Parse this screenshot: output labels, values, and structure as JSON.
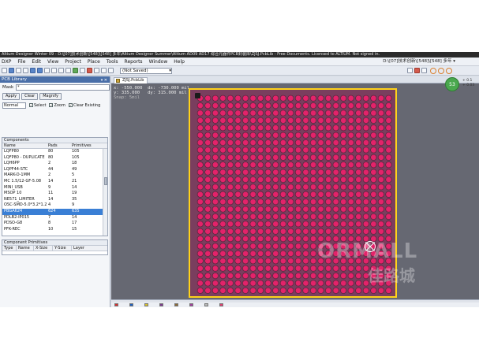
{
  "window": {
    "title": "Altium Designer Winter 09 - D:\\[07]技术创新\\[548]\\[548] 多年\\Altium Designer Summer\\Altium AD09 AD17 综合元器件PCB封装库\\ZJSJ.PcbLib - Free Documents. Licensed to ALTIUM. Not signed in."
  },
  "menu": [
    "DXP",
    "File",
    "Edit",
    "View",
    "Project",
    "Place",
    "Tools",
    "Reports",
    "Window",
    "Help"
  ],
  "path_label": "D:\\[07]技术创新\\[548]\\[548] 多年 ▾",
  "toolbar": {
    "variant": "(Not Saved)"
  },
  "panel": {
    "title": "PCB Library",
    "mask_label": "Mask",
    "mask_value": "*",
    "buttons": {
      "apply": "Apply",
      "clear": "Clear",
      "magnify": "Magnify"
    },
    "mode": "Normal",
    "options": {
      "select": "Select",
      "zoom": "Zoom",
      "clear_existing": "Clear Existing"
    },
    "components": {
      "title": "Components",
      "headers": [
        "Name",
        "Pads",
        "Primitives"
      ],
      "rows": [
        [
          "LQFP80",
          "80",
          "105"
        ],
        [
          "LQFP80 - DUPLICATE",
          "80",
          "105"
        ],
        [
          "LQH6PP",
          "2",
          "18"
        ],
        [
          "LQPF44-STC",
          "44",
          "49"
        ],
        [
          "MARK-D-1MM",
          "2",
          "5"
        ],
        [
          "MC 1.5/12-GF-5.08",
          "14",
          "21"
        ],
        [
          "MINI_USB",
          "9",
          "14"
        ],
        [
          "MSOP 10",
          "11",
          "19"
        ],
        [
          "NE571_LIMITER",
          "14",
          "35"
        ],
        [
          "OSC-SMD-5.0*3.2*1.2",
          "4",
          "9"
        ],
        [
          "PBGA624",
          "624",
          "635"
        ],
        [
          "PDLB2-IP015",
          "7",
          "14"
        ],
        [
          "PDSO-G8",
          "8",
          "17"
        ],
        [
          "PFK-REC",
          "10",
          "15"
        ]
      ],
      "selected_index": 10
    },
    "primitives": {
      "title": "Component Primitives",
      "headers": [
        "Type",
        "Name",
        "X-Size",
        "Y-Size",
        "Layer"
      ]
    }
  },
  "document": {
    "tab": "ZJSJ.PcbLib",
    "coords": {
      "x": "x: -550.000",
      "dx": "dx: -730.000 mil",
      "y": "y: 335.000",
      "dy": "dy: 315.000 mil",
      "snap": "Snap: 5mil"
    }
  },
  "badge": {
    "value": "53"
  },
  "right_readout": [
    "+ 0.1",
    "+ 0.03"
  ],
  "watermark": {
    "text": "ORMALL",
    "cn": "佳路城"
  },
  "colors": {
    "canvas": "#666872",
    "board": "#7a3e5e",
    "pad": "#e3236a",
    "outline": "#ffd21a",
    "selection": "#3a7fd5"
  }
}
